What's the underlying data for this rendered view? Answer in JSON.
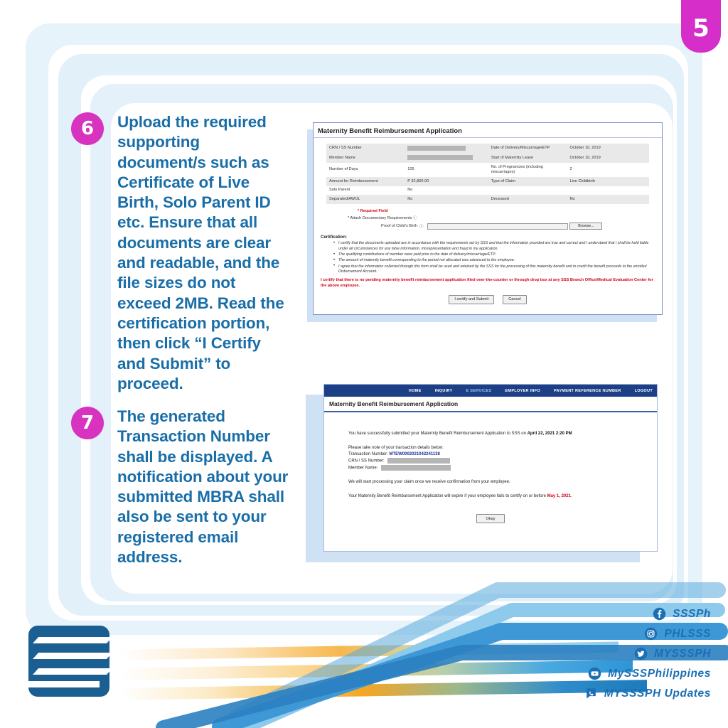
{
  "badge": {
    "top_number": "5"
  },
  "steps": [
    {
      "number": "6",
      "text": "Upload the required supporting document/s such as Certificate of Live Birth, Solo Parent ID etc. Ensure that all documents are clear and readable, and the file sizes do not exceed 2MB. Read the certification portion, then click “I Certify and Submit” to proceed."
    },
    {
      "number": "7",
      "text": "The generated Transaction Number shall be displayed. A notification about your submitted MBRA shall also be sent to your registered email address."
    }
  ],
  "screenshot1": {
    "title": "Maternity Benefit Reimbursement Application",
    "table": [
      {
        "label": "CRN / SS Number",
        "value": "",
        "redacted": true,
        "label2": "Date of Delivery/Miscarriage/ETP",
        "value2": "October 10, 2019"
      },
      {
        "label": "Member Name",
        "value": "",
        "redacted": true,
        "label2": "Start of Maternity Leave",
        "value2": "October 10, 2019"
      },
      {
        "label": "Number of Days",
        "value": "105",
        "redacted": false,
        "label2": "No. of Pregnancies (including miscarriages)",
        "value2": "2"
      },
      {
        "label": "Amount for Reimbursement",
        "value": "P 32,800.00",
        "redacted": false,
        "label2": "Type of Claim",
        "value2": "Live Childbirth"
      },
      {
        "label": "Solo Parent",
        "value": "No",
        "redacted": false,
        "label2": "",
        "value2": ""
      },
      {
        "label": "Separated/AWOL",
        "value": "No",
        "redacted": false,
        "label2": "Deceased",
        "value2": "No"
      }
    ],
    "required_field_note": "* Required Field",
    "attach_label": "* Attach Documentary Requirements",
    "proof_label": "Proof of Child's Birth",
    "file_value": "",
    "browse_button": "Browse...",
    "certification_heading": "Certification:",
    "certification_bullets": [
      "I certify that the documents uploaded are in accordance with the requirements set by SSS and that the information provided are true and correct and I understand that I shall be held liable under all circumstances for any false information, misrepresentation and fraud in my application.",
      "The qualifying contributions of member were paid prior to the date of delivery/miscarriage/ETP.",
      "The amount of maternity benefit corresponding to the period not allocated was advanced to the employee.",
      "I agree that the information collected through this form shall be used and retained by the SSS for the processing of this maternity benefit and to credit the benefit proceeds to the enrolled Disbursement Account."
    ],
    "red_certification": "I certify that there is no pending maternity benefit reimbursement application filed over-the-counter or through drop box at any SSS Branch Office/Medical Evaluation Center for the above employee.",
    "submit_button": "I certify and Submit",
    "cancel_button": "Cancel"
  },
  "screenshot2": {
    "nav": [
      "HOME",
      "INQUIRY",
      "E SERVICES",
      "EMPLOYER INFO",
      "PAYMENT REFERENCE NUMBER",
      "LOGOUT"
    ],
    "nav_active": "E SERVICES",
    "title": "Maternity Benefit Reimbursement Application",
    "success_prefix": "You have successfully submitted your Maternity Benefit Reimbursement Application to SSS on ",
    "success_datetime": "April 22, 2021 2:20 PM",
    "take_note": "Please take note of your transaction details below:",
    "transaction_label": "Transaction Number: ",
    "transaction_number": "MTEW0002021042241138",
    "crn_label": "CRN / SS Number:",
    "member_label": "Member Name:",
    "processing_note": "We will start processing your claim once we receive confirmation from your employee.",
    "expiry_prefix": "Your Maternity Benefit Reimbursement Application will expire if your employee fails to certify on or before ",
    "expiry_date": "May 1, 2021",
    "expiry_suffix": ".",
    "okay_button": "Okay"
  },
  "socials": [
    {
      "icon": "facebook-icon",
      "name": "SSSPh"
    },
    {
      "icon": "instagram-icon",
      "name": "PHLSSS"
    },
    {
      "icon": "twitter-icon",
      "name": "MYSSSPH"
    },
    {
      "icon": "youtube-icon",
      "name": "MySSSPhilippines"
    },
    {
      "icon": "viber-icon",
      "name": "MYSSSPH Updates"
    }
  ],
  "colors": {
    "magenta": "#d733bf",
    "step_text_blue": "#1a6ea8",
    "nav_blue": "#1c3f86",
    "logo_blue": "#1b5e91",
    "social_blue": "#1a6fb5",
    "red": "#d0021b",
    "transaction_blue": "#1d2ea0"
  }
}
